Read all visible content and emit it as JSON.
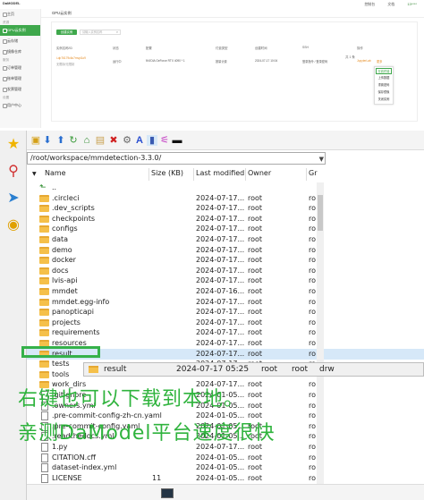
{
  "web": {
    "brand": "DaMODEL",
    "top_links": [
      "控制台",
      "文档",
      "13****"
    ],
    "sidebar": {
      "sections": [
        {
          "title": "",
          "items": [
            "主页"
          ]
        },
        {
          "title": "资源",
          "items": [
            "GPU云实例",
            "云存储",
            "镜像仓库"
          ]
        },
        {
          "title": "服务",
          "items": [
            "订单管理",
            "账单管理",
            "发票管理"
          ]
        },
        {
          "title": "设置",
          "items": [
            "用户中心"
          ]
        }
      ],
      "active_item": "GPU云实例"
    },
    "page_title": "GPU云实例",
    "create_button": "创建实例",
    "search_placeholder": "请输入实例名称",
    "table_headers": [
      "实例名称/ID",
      "状态",
      "配置",
      "付费类型",
      "创建时间",
      "SSH",
      "操作"
    ],
    "row": {
      "id": "i-dp76179c6c7mvpl1o9",
      "sub": "无限制/无限制",
      "status": "运行中",
      "gpu": "NVIDIA GeForce RTX 4090 * 1",
      "billing": "按量计费",
      "created": "2024-07-17 10:04",
      "ssh": "登录指令 / 登录密码",
      "ops": [
        "JupyterLab",
        "更多"
      ]
    },
    "pager": "共 1 条",
    "context_menu": [
      "在线终端",
      "上传数据",
      "重置密码",
      "保存镜像",
      "关闭实例"
    ],
    "context_menu_selected": 0
  },
  "filemanager": {
    "path": "/root/workspace/mmdetection-3.3.0/",
    "columns": [
      "Name",
      "Size (KB)",
      "Last modified",
      "Owner",
      "Gr"
    ],
    "files": [
      {
        "name": "..",
        "size": "",
        "modified": "",
        "owner": "",
        "group": "",
        "type": "up"
      },
      {
        "name": ".circleci",
        "size": "",
        "modified": "2024-07-17...",
        "owner": "root",
        "group": "ro",
        "type": "folder"
      },
      {
        "name": ".dev_scripts",
        "size": "",
        "modified": "2024-07-17...",
        "owner": "root",
        "group": "ro",
        "type": "folder"
      },
      {
        "name": "checkpoints",
        "size": "",
        "modified": "2024-07-17...",
        "owner": "root",
        "group": "ro",
        "type": "folder"
      },
      {
        "name": "configs",
        "size": "",
        "modified": "2024-07-17...",
        "owner": "root",
        "group": "ro",
        "type": "folder"
      },
      {
        "name": "data",
        "size": "",
        "modified": "2024-07-17...",
        "owner": "root",
        "group": "ro",
        "type": "folder"
      },
      {
        "name": "demo",
        "size": "",
        "modified": "2024-07-17...",
        "owner": "root",
        "group": "ro",
        "type": "folder"
      },
      {
        "name": "docker",
        "size": "",
        "modified": "2024-07-17...",
        "owner": "root",
        "group": "ro",
        "type": "folder"
      },
      {
        "name": "docs",
        "size": "",
        "modified": "2024-07-17...",
        "owner": "root",
        "group": "ro",
        "type": "folder"
      },
      {
        "name": "lvis-api",
        "size": "",
        "modified": "2024-07-17...",
        "owner": "root",
        "group": "ro",
        "type": "folder"
      },
      {
        "name": "mmdet",
        "size": "",
        "modified": "2024-07-16...",
        "owner": "root",
        "group": "ro",
        "type": "folder"
      },
      {
        "name": "mmdet.egg-info",
        "size": "",
        "modified": "2024-07-17...",
        "owner": "root",
        "group": "ro",
        "type": "folder"
      },
      {
        "name": "panopticapi",
        "size": "",
        "modified": "2024-07-17...",
        "owner": "root",
        "group": "ro",
        "type": "folder"
      },
      {
        "name": "projects",
        "size": "",
        "modified": "2024-07-17...",
        "owner": "root",
        "group": "ro",
        "type": "folder"
      },
      {
        "name": "requirements",
        "size": "",
        "modified": "2024-07-17...",
        "owner": "root",
        "group": "ro",
        "type": "folder"
      },
      {
        "name": "resources",
        "size": "",
        "modified": "2024-07-17...",
        "owner": "root",
        "group": "ro",
        "type": "folder"
      },
      {
        "name": "result",
        "size": "",
        "modified": "2024-07-17...",
        "owner": "root",
        "group": "ro",
        "type": "folder"
      },
      {
        "name": "tests",
        "size": "",
        "modified": "2024-07-17...",
        "owner": "root",
        "group": "ro",
        "type": "folder"
      },
      {
        "name": "tools",
        "size": "",
        "modified": "2024-07-17...",
        "owner": "root",
        "group": "ro",
        "type": "folder"
      },
      {
        "name": "work_dirs",
        "size": "",
        "modified": "2024-07-17...",
        "owner": "root",
        "group": "ro",
        "type": "folder"
      },
      {
        "name": ".gitignore",
        "size": "",
        "modified": "2024-01-05...",
        "owner": "root",
        "group": "ro",
        "type": "file"
      },
      {
        "name": ".owners.yml",
        "size": "",
        "modified": "2024-01-05...",
        "owner": "root",
        "group": "ro",
        "type": "file"
      },
      {
        "name": ".pre-commit-config-zh-cn.yaml",
        "size": "",
        "modified": "2024-01-05...",
        "owner": "root",
        "group": "ro",
        "type": "file"
      },
      {
        "name": ".pre-commit-config.yaml",
        "size": "",
        "modified": "2024-01-05...",
        "owner": "root",
        "group": "ro",
        "type": "file"
      },
      {
        "name": ".readthedocs.yml",
        "size": "",
        "modified": "2024-01-05...",
        "owner": "root",
        "group": "ro",
        "type": "file"
      },
      {
        "name": "1.py",
        "size": "",
        "modified": "2024-07-17...",
        "owner": "root",
        "group": "ro",
        "type": "file"
      },
      {
        "name": "CITATION.cff",
        "size": "",
        "modified": "2024-01-05...",
        "owner": "root",
        "group": "ro",
        "type": "file"
      },
      {
        "name": "dataset-index.yml",
        "size": "",
        "modified": "2024-01-05...",
        "owner": "root",
        "group": "ro",
        "type": "file"
      },
      {
        "name": "LICENSE",
        "size": "11",
        "modified": "2024-01-05...",
        "owner": "root",
        "group": "ro",
        "type": "file"
      }
    ],
    "selected_index": 16,
    "drag_tip": {
      "name": "result",
      "modified": "2024-07-17 05:25",
      "owner": "root",
      "group": "root",
      "perm": "drw"
    }
  },
  "overlay": {
    "line1": "右键也可以下载到本地。",
    "line2": "亲测DaModel平台速度很快"
  },
  "colors": {
    "accent": "#3fa84c",
    "overlay": "#2fb33d",
    "highlight_box": "#35b14a"
  },
  "icons": [
    "star-icon",
    "usb-icon",
    "send-icon",
    "chrome-icon"
  ]
}
